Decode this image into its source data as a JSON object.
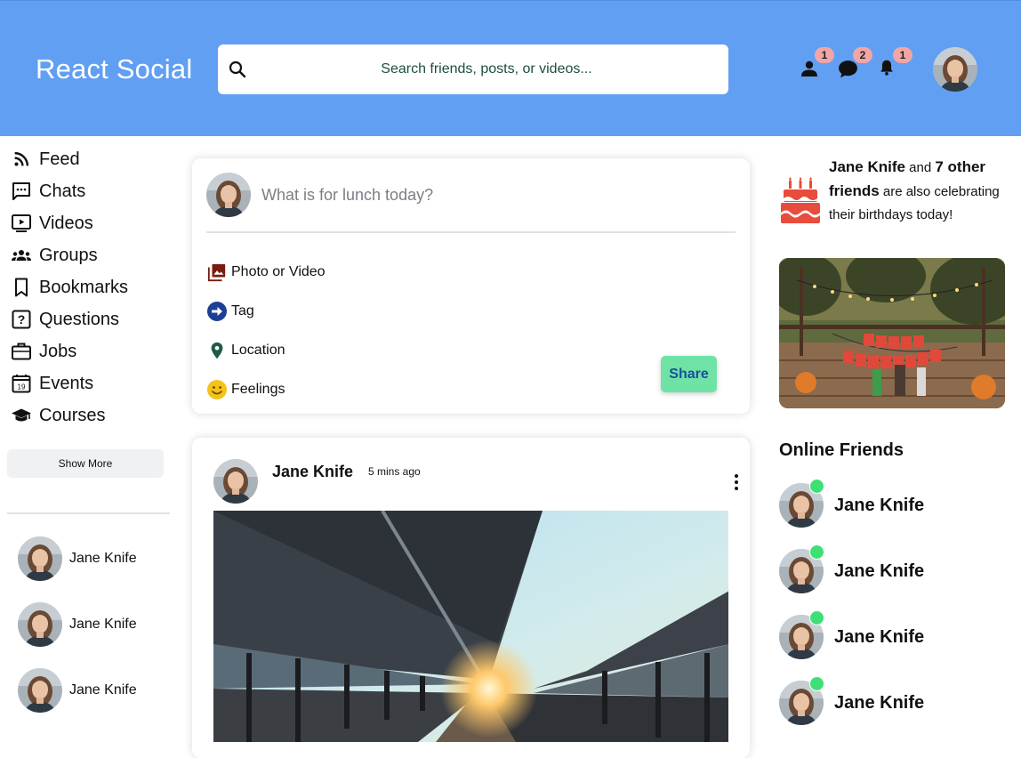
{
  "topbar": {
    "logo": "React Social",
    "search_placeholder": "Search friends, posts, or videos...",
    "badges": {
      "friend_requests": "1",
      "messages": "2",
      "notifications": "1"
    },
    "colors": {
      "background": "#619ff2",
      "badge": "#f2a5a5"
    }
  },
  "sidebar": {
    "items": [
      {
        "label": "Feed",
        "icon": "rss-feed-icon"
      },
      {
        "label": "Chats",
        "icon": "chat-icon"
      },
      {
        "label": "Videos",
        "icon": "video-icon"
      },
      {
        "label": "Groups",
        "icon": "groups-icon"
      },
      {
        "label": "Bookmarks",
        "icon": "bookmark-icon"
      },
      {
        "label": "Questions",
        "icon": "question-icon"
      },
      {
        "label": "Jobs",
        "icon": "briefcase-icon"
      },
      {
        "label": "Events",
        "icon": "calendar-icon"
      },
      {
        "label": "Courses",
        "icon": "graduation-cap-icon"
      }
    ],
    "show_more": "Show More",
    "friends": [
      "Jane Knife",
      "Jane Knife",
      "Jane Knife"
    ]
  },
  "share": {
    "placeholder": "What is for lunch today?",
    "options": [
      {
        "label": "Photo or Video",
        "icon": "photo-library-icon"
      },
      {
        "label": "Tag",
        "icon": "tag-arrow-icon"
      },
      {
        "label": "Location",
        "icon": "location-pin-icon"
      },
      {
        "label": "Feelings",
        "icon": "smiley-icon"
      }
    ],
    "button": "Share",
    "colors": {
      "button": "#6fe3a6",
      "button_text": "#1b4e9b"
    }
  },
  "post": {
    "username": "Jane Knife",
    "time": "5 mins ago"
  },
  "rightbar": {
    "birthday": {
      "name": "Jane Knife",
      "and": " and ",
      "others": "7 other friends",
      "rest": " are also celebrating their birthdays today!"
    },
    "online_title": "Online Friends",
    "online_friends": [
      "Jane Knife",
      "Jane Knife",
      "Jane Knife",
      "Jane Knife"
    ],
    "colors": {
      "online_dot": "#3ee076"
    }
  }
}
